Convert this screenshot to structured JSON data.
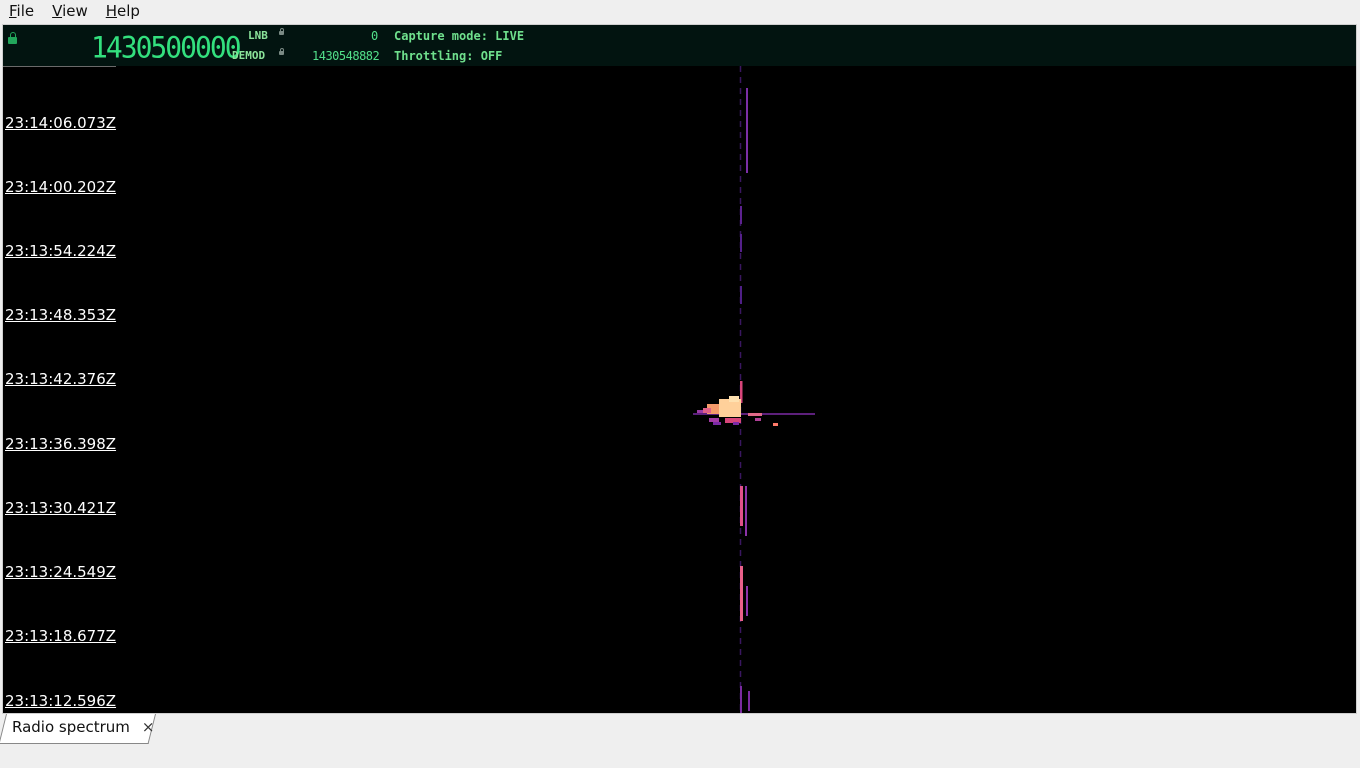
{
  "menu": [
    {
      "label": "File",
      "underline": "F",
      "rest": "ile"
    },
    {
      "label": "View",
      "underline": "V",
      "rest": "iew"
    },
    {
      "label": "Help",
      "underline": "H",
      "rest": "elp"
    }
  ],
  "header": {
    "main_frequency": "1430500000",
    "lnb_label": "LNB",
    "lnb_value": "0",
    "demod_label": "DEMOD",
    "demod_value": "1430548882",
    "capture_mode": "Capture mode: LIVE",
    "throttling": "Throttling: OFF"
  },
  "waterfall": {
    "timestamps": [
      "23:14:06.073Z",
      "23:14:00.202Z",
      "23:13:54.224Z",
      "23:13:48.353Z",
      "23:13:42.376Z",
      "23:13:36.398Z",
      "23:13:30.421Z",
      "23:13:24.549Z",
      "23:13:18.677Z",
      "23:13:12.596Z"
    ]
  },
  "tabs": [
    {
      "label": "Radio spectrum",
      "close_glyph": "×"
    }
  ]
}
